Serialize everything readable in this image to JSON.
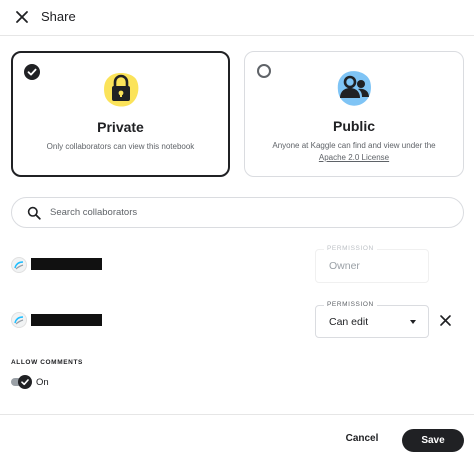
{
  "dialog": {
    "title": "Share"
  },
  "visibility": {
    "private": {
      "title": "Private",
      "description": "Only collaborators can view this notebook",
      "selected": true,
      "icon": "lock-icon",
      "accent_color": "#fbe35a"
    },
    "public": {
      "title": "Public",
      "description": "Anyone at Kaggle can find and view under the",
      "link_text": "Apache 2.0 License",
      "selected": false,
      "icon": "people-icon",
      "accent_color": "#7fc4f5"
    }
  },
  "search": {
    "placeholder": "Search collaborators",
    "icon": "search-icon"
  },
  "collaborators": [
    {
      "permission_label": "PERMISSION",
      "permission": "Owner",
      "editable": false
    },
    {
      "permission_label": "PERMISSION",
      "permission": "Can edit",
      "editable": true
    }
  ],
  "comments": {
    "label": "ALLOW COMMENTS",
    "state_text": "On",
    "enabled": true
  },
  "footer": {
    "cancel_label": "Cancel",
    "save_label": "Save"
  },
  "colors": {
    "primary": "#202124",
    "border": "#dadce0",
    "muted_text": "#5f6368"
  }
}
